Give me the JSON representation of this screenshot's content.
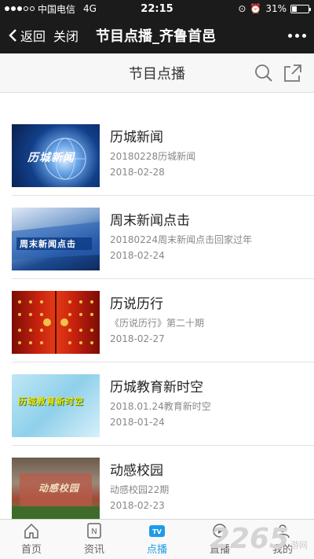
{
  "status": {
    "carrier": "中国电信",
    "network": "4G",
    "time": "22:15",
    "battery": "31%",
    "battery_level": 0.31
  },
  "nav": {
    "back_label": "返回",
    "close_label": "关闭",
    "title": "节目点播_齐鲁首邑"
  },
  "sub": {
    "title": "节目点播"
  },
  "programs": [
    {
      "name": "历城新闻",
      "desc": "20180228历城新闻",
      "date": "2018-02-28",
      "thumb_text": "历城新闻"
    },
    {
      "name": "周末新闻点击",
      "desc": "20180224周末新闻点击回家过年",
      "date": "2018-02-24",
      "thumb_text": "周末新闻点击"
    },
    {
      "name": "历说历行",
      "desc": "《历说历行》第二十期",
      "date": "2018-02-27",
      "thumb_text": ""
    },
    {
      "name": "历城教育新时空",
      "desc": "2018.01.24教育新时空",
      "date": "2018-01-24",
      "thumb_text": "历城教育新时空"
    },
    {
      "name": "动感校园",
      "desc": "动感校园22期",
      "date": "2018-02-23",
      "thumb_text": "动感校园"
    }
  ],
  "tabs": [
    {
      "label": "首页",
      "icon": "home-icon"
    },
    {
      "label": "资讯",
      "icon": "news-icon"
    },
    {
      "label": "点播",
      "icon": "tv-icon",
      "badge": "TV"
    },
    {
      "label": "直播",
      "icon": "live-icon"
    },
    {
      "label": "我的",
      "icon": "profile-icon"
    }
  ],
  "watermark": {
    "big": "2265",
    "small": "游网"
  },
  "colors": {
    "accent": "#1e9be8",
    "navbar": "#1b1b1b"
  }
}
